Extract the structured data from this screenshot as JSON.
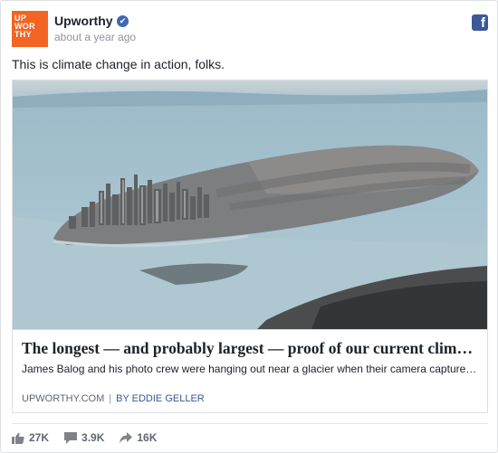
{
  "post": {
    "page_name": "Upworthy",
    "logo_lines": [
      "UP",
      "WOR",
      "THY"
    ],
    "timestamp": "about a year ago",
    "verified_glyph": "✔",
    "text": "This is climate change in action, folks."
  },
  "link": {
    "title": "The longest — and probably largest — proof of our current climate ...",
    "description": "James Balog and his photo crew were hanging out near a glacier when their camera captured somet...",
    "source": "UPWORTHY.COM",
    "separator": "|",
    "byline": "BY EDDIE GELLER"
  },
  "stats": {
    "likes": "27K",
    "comments": "3.9K",
    "shares": "16K"
  },
  "colors": {
    "brand_orange": "#f26522",
    "facebook_blue": "#3b5998",
    "verified_blue": "#4267b2",
    "glacier": "#a9c4cf"
  },
  "icons": {
    "facebook": "facebook-icon",
    "verified": "verified-badge-icon",
    "like": "thumbs-up-icon",
    "comment": "comment-icon",
    "share": "share-arrow-icon"
  }
}
